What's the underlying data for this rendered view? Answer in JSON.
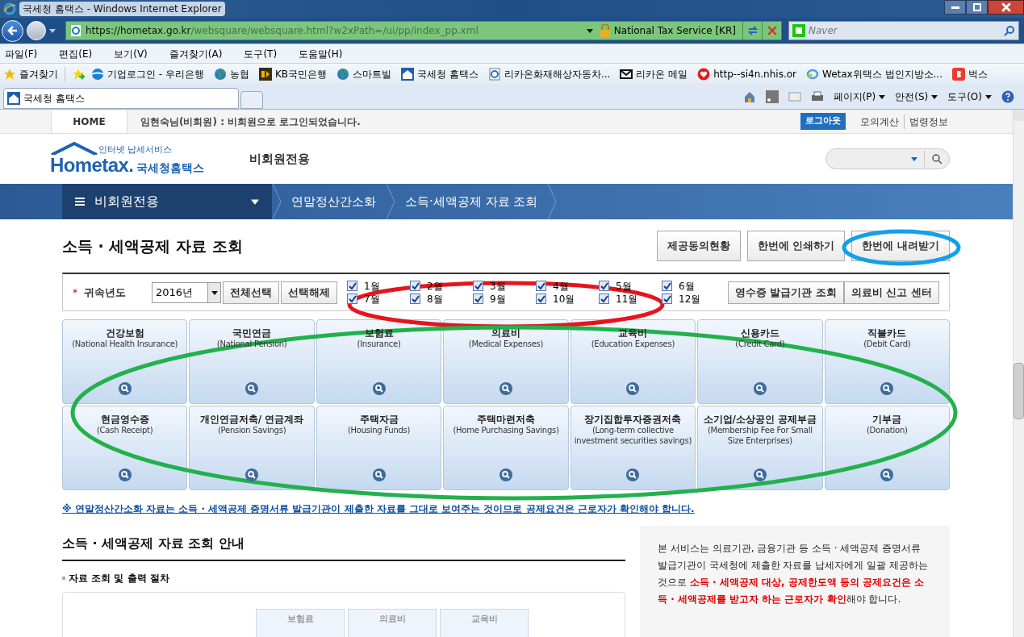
{
  "window": {
    "title": "국세청 홈택스 - Windows Internet Explorer"
  },
  "address_bar": {
    "url_host": "https://hometax.go.kr",
    "url_path": "/websquare/websquare.html?w2xPath=/ui/pp/index_pp.xml",
    "site_identity": "National Tax Service [KR]"
  },
  "search": {
    "placeholder": "Naver"
  },
  "menu": [
    "파일(F)",
    "편집(E)",
    "보기(V)",
    "즐겨찾기(A)",
    "도구(T)",
    "도움말(H)"
  ],
  "favorites_button": "즐겨찾기",
  "favorites": [
    {
      "label": "기업로그인 - 우리은행",
      "kind": "wave"
    },
    {
      "label": "농협",
      "kind": "globe"
    },
    {
      "label": "KB국민은행",
      "kind": "kb"
    },
    {
      "label": "스마트빌",
      "kind": "globe"
    },
    {
      "label": "국세청 홈택스",
      "kind": "house"
    },
    {
      "label": "리카온화재해상자동차...",
      "kind": "page"
    },
    {
      "label": "리카온 메일",
      "kind": "mail"
    },
    {
      "label": "http--si4n.nhis.or",
      "kind": "heart"
    },
    {
      "label": "Wetax위택스 법인지방소...",
      "kind": "ring"
    },
    {
      "label": "벅스",
      "kind": "letter"
    }
  ],
  "tabs": [
    {
      "label": "국세청 홈택스",
      "selected": true
    }
  ],
  "command_bar": [
    "페이지(P)",
    "안전(S)",
    "도구(O)"
  ],
  "site": {
    "home": "HOME",
    "login_message": "임현숙님(비회원) : 비회원으로 로그인되었습니다.",
    "logout": "로그아웃",
    "links": [
      "모의계산",
      "법령정보"
    ],
    "logo_tagline": "인터넷 납세서비스",
    "logo_en": "Hometax.",
    "logo_kr": "국세청홈택스",
    "section": "비회원전용"
  },
  "nav": {
    "menu": "비회원전용",
    "breadcrumbs": [
      "연말정산간소화",
      "소득·세액공제 자료 조회"
    ]
  },
  "page_title": "소득 · 세액공제 자료 조회",
  "actions": [
    "제공동의현황",
    "한번에 인쇄하기",
    "한번에 내려받기"
  ],
  "filter": {
    "required_mark": "*",
    "label": "귀속년도",
    "year": "2016년",
    "buttons": [
      "전체선택",
      "선택해제"
    ],
    "months": [
      {
        "label": "1월",
        "checked": true
      },
      {
        "label": "2월",
        "checked": true
      },
      {
        "label": "3월",
        "checked": true
      },
      {
        "label": "4월",
        "checked": true
      },
      {
        "label": "5월",
        "checked": true
      },
      {
        "label": "6월",
        "checked": true
      },
      {
        "label": "7월",
        "checked": true
      },
      {
        "label": "8월",
        "checked": true
      },
      {
        "label": "9월",
        "checked": true
      },
      {
        "label": "10월",
        "checked": true
      },
      {
        "label": "11월",
        "checked": true
      },
      {
        "label": "12월",
        "checked": true
      }
    ],
    "right_buttons": [
      "영수증 발급기관 조회",
      "의료비 신고 센터"
    ]
  },
  "categories": [
    {
      "title": "건강보험",
      "subtitle": "(National Health Insurance)"
    },
    {
      "title": "국민연금",
      "subtitle": "(National Pension)"
    },
    {
      "title": "보험료",
      "subtitle": "(Insurance)"
    },
    {
      "title": "의료비",
      "subtitle": "(Medical Expenses)"
    },
    {
      "title": "교육비",
      "subtitle": "(Education Expenses)"
    },
    {
      "title": "신용카드",
      "subtitle": "(Credit Card)"
    },
    {
      "title": "직불카드",
      "subtitle": "(Debit Card)"
    },
    {
      "title": "현금영수증",
      "subtitle": "(Cash Receipt)"
    },
    {
      "title": "개인연금저축/ 연금계좌",
      "subtitle": "(Pension Savings)"
    },
    {
      "title": "주택자금",
      "subtitle": "(Housing Funds)"
    },
    {
      "title": "주택마련저축",
      "subtitle": "(Home Purchasing Savings)"
    },
    {
      "title": "장기집합투자증권저축",
      "subtitle": "(Long-term collective investment securities savings)"
    },
    {
      "title": "소기업/소상공인 공제부금",
      "subtitle": "(Membership Fee For Small Size Enterprises)"
    },
    {
      "title": "기부금",
      "subtitle": "(Donation)"
    }
  ],
  "notice": "※ 연말정산간소화 자료는 소득 · 세액공제 증명서류 발급기관이 제출한 자료를 그대로 보여주는 것이므로 공제요건은 근로자가 확인해야 합니다.",
  "guide": {
    "heading": "소득 · 세액공제 자료 조회 안내",
    "subheading": "자료 조회 및 출력 절차",
    "steps": [
      "보험료",
      "의료비",
      "교육비"
    ]
  },
  "info": "본 서비스는 의료기관, 금융기관 등 소득 · 세액공제 증명서류 발급기관이 국세청에 제출한 자료를 납세자에게 일괄 제공하는 것으로 **소득 · 세액공제 대상, 공제한도액 등의 공제요건은 소득 · 세액공제를 받고자 하는 근로자가 확인**해야 합니다."
}
